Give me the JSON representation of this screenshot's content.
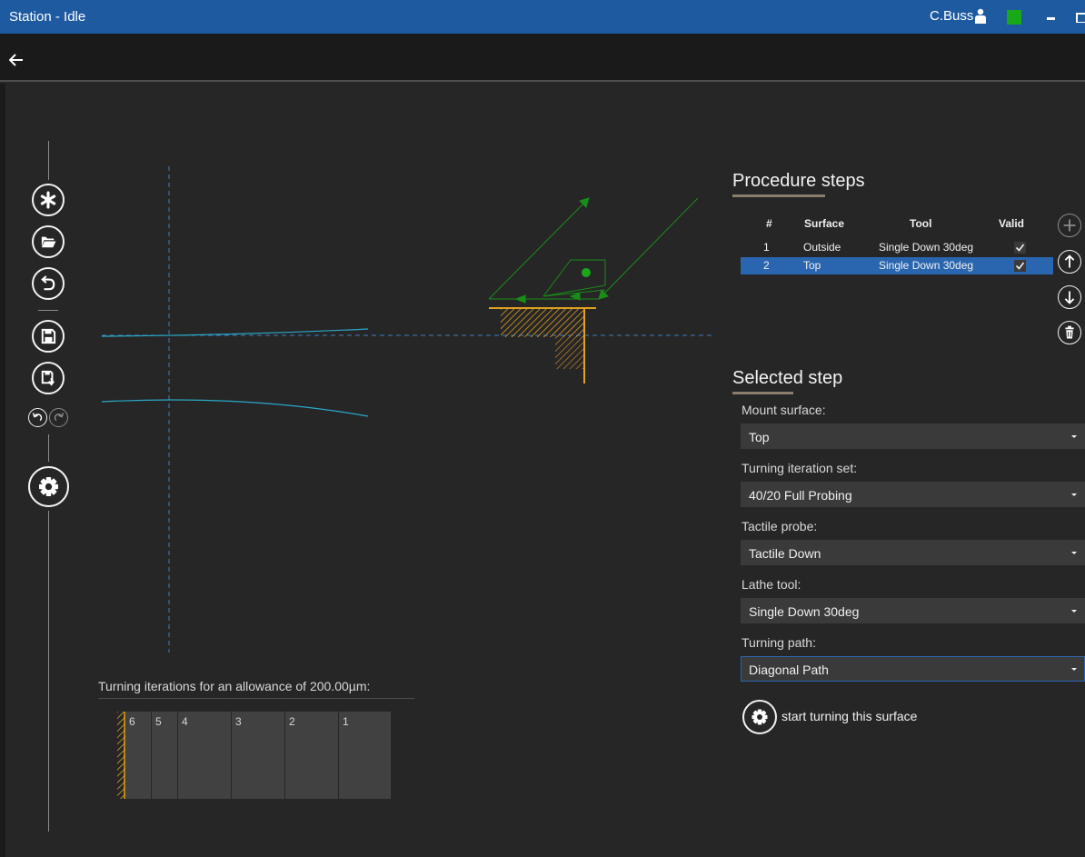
{
  "window": {
    "title": "Station - Idle",
    "user": "C.Buss",
    "status_color": "#18a818",
    "accent_color": "#1e5aa0"
  },
  "nav": {
    "back_icon": "arrow-left-icon"
  },
  "toolbar": {
    "buttons": [
      {
        "icon": "new-asterisk-icon",
        "enabled": true
      },
      {
        "icon": "open-folder-icon",
        "enabled": true
      },
      {
        "icon": "revert-icon",
        "enabled": true
      },
      {
        "icon": "save-icon",
        "enabled": true
      },
      {
        "icon": "save-as-icon",
        "enabled": true
      },
      {
        "icon": "undo-icon",
        "enabled": true
      },
      {
        "icon": "redo-icon",
        "enabled": false
      },
      {
        "icon": "settings-gear-icon",
        "enabled": true
      }
    ]
  },
  "iterations": {
    "label": "Turning iterations for an allowance of 200.00µm:",
    "items": [
      "6",
      "5",
      "4",
      "3",
      "2",
      "1"
    ]
  },
  "procedure": {
    "title": "Procedure steps",
    "columns": {
      "num": "#",
      "surface": "Surface",
      "tool": "Tool",
      "valid": "Valid"
    },
    "rows": [
      {
        "num": "1",
        "surface": "Outside",
        "tool": "Single Down 30deg",
        "valid": true,
        "selected": false
      },
      {
        "num": "2",
        "surface": "Top",
        "tool": "Single Down 30deg",
        "valid": true,
        "selected": true
      }
    ],
    "side_buttons": [
      {
        "icon": "add-icon",
        "enabled": false
      },
      {
        "icon": "move-up-icon",
        "enabled": true
      },
      {
        "icon": "move-down-icon",
        "enabled": true
      },
      {
        "icon": "delete-icon",
        "enabled": true
      }
    ]
  },
  "selected_step": {
    "title": "Selected step",
    "fields": {
      "mount_surface": {
        "label": "Mount surface:",
        "value": "Top"
      },
      "iteration_set": {
        "label": "Turning iteration set:",
        "value": "40/20 Full Probing"
      },
      "tactile_probe": {
        "label": "Tactile probe:",
        "value": "Tactile Down"
      },
      "lathe_tool": {
        "label": "Lathe tool:",
        "value": "Single Down 30deg"
      },
      "turning_path": {
        "label": "Turning path:",
        "value": "Diagonal Path"
      }
    },
    "start_label": "start turning this surface"
  },
  "colors": {
    "background": "#262626",
    "selection": "#2a66b0",
    "path_green": "#1a8c1a",
    "surface_orange": "#e0a020",
    "profile_cyan": "#2aa8c8"
  }
}
